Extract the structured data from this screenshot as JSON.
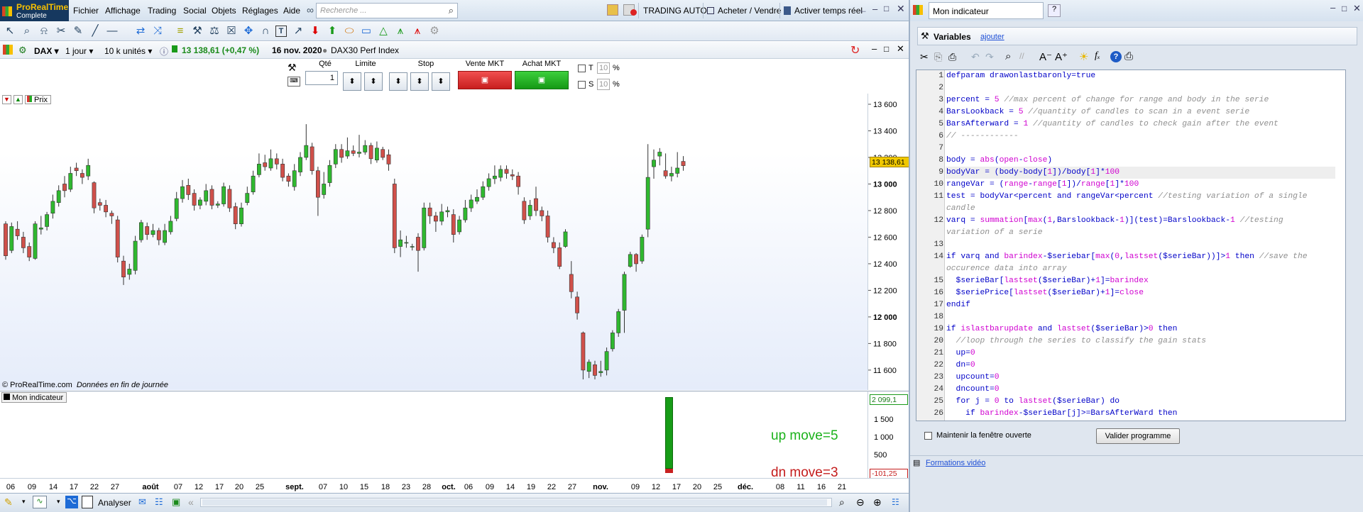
{
  "app": {
    "name_line1": "ProRealTime",
    "name_line2": "Complete"
  },
  "menu": [
    "Fichier",
    "Affichage",
    "Trading",
    "Social",
    "Objets",
    "Réglages",
    "Aide"
  ],
  "search": {
    "placeholder": "Recherche ..."
  },
  "topbar": {
    "trading_auto": "TRADING AUTO",
    "buy_sell": "Acheter / Vendre",
    "realtime": "Activer temps réel"
  },
  "chart_header": {
    "symbol": "DAX",
    "period": "1 jour",
    "units": "10 k unités",
    "price": "13 138,61 (+0,47 %)",
    "date": "16 nov. 2020",
    "name": "DAX30 Perf Index"
  },
  "order": {
    "qty_label": "Qté",
    "qty_value": "1",
    "limit_label": "Limite",
    "stop_label": "Stop",
    "sell_label": "Vente MKT",
    "buy_label": "Achat MKT",
    "t_label": "T",
    "t_value": "10",
    "s_label": "S",
    "s_value": "10",
    "pct": "%"
  },
  "chart": {
    "price_tab": "Prix",
    "copyright": "© ProRealTime.com",
    "eod_note": "Données en fin de journée",
    "current_price_tag": "13 138,61",
    "indicator_tab": "Mon indicateur",
    "up_move_label": "up move=5",
    "dn_move_label": "dn move=3",
    "indicator_top_tag": "2 099,1",
    "indicator_bottom_tag": "-101,25"
  },
  "chart_data": {
    "type": "candlestick",
    "y_ticks": [
      "13 600",
      "13 400",
      "13 200",
      "13 000",
      "12 800",
      "12 600",
      "12 400",
      "12 200",
      "12 000",
      "11 800",
      "11 600"
    ],
    "ylim": [
      11450,
      13680
    ],
    "x_ticks": [
      "06",
      "09",
      "14",
      "17",
      "22",
      "27",
      "août",
      "07",
      "12",
      "17",
      "20",
      "25",
      "sept.",
      "07",
      "10",
      "15",
      "18",
      "23",
      "28",
      "oct.",
      "06",
      "09",
      "14",
      "19",
      "22",
      "27",
      "nov.",
      "09",
      "12",
      "17",
      "20",
      "25",
      "déc.",
      "08",
      "11",
      "16",
      "21"
    ],
    "indicator_ticks": [
      "1 500",
      "1 000",
      "500"
    ],
    "indicator_ylim": [
      -101.25,
      2099.1
    ],
    "candles": [
      [
        12700,
        12460,
        12720,
        12430
      ],
      [
        12500,
        12680,
        12710,
        12480
      ],
      [
        12660,
        12610,
        12720,
        12580
      ],
      [
        12600,
        12520,
        12640,
        12480
      ],
      [
        12530,
        12450,
        12560,
        12420
      ],
      [
        12440,
        12700,
        12720,
        12430
      ],
      [
        12660,
        12670,
        12760,
        12620
      ],
      [
        12680,
        12770,
        12790,
        12650
      ],
      [
        12780,
        12870,
        12920,
        12740
      ],
      [
        12860,
        12950,
        12990,
        12830
      ],
      [
        13000,
        12950,
        13060,
        12900
      ],
      [
        12960,
        13080,
        13130,
        12940
      ],
      [
        13120,
        13100,
        13160,
        13060
      ],
      [
        13080,
        13050,
        13110,
        13000
      ],
      [
        13060,
        13140,
        13190,
        13030
      ],
      [
        13010,
        12820,
        13020,
        12780
      ],
      [
        12860,
        12840,
        12890,
        12800
      ],
      [
        12840,
        12790,
        12880,
        12750
      ],
      [
        12780,
        12760,
        12800,
        12700
      ],
      [
        12730,
        12450,
        12760,
        12410
      ],
      [
        12420,
        12300,
        12460,
        12240
      ],
      [
        12320,
        12360,
        12400,
        12280
      ],
      [
        12350,
        12570,
        12610,
        12320
      ],
      [
        12580,
        12710,
        12730,
        12560
      ],
      [
        12680,
        12620,
        12710,
        12580
      ],
      [
        12620,
        12650,
        12700,
        12600
      ],
      [
        12650,
        12580,
        12670,
        12540
      ],
      [
        12560,
        12650,
        12700,
        12540
      ],
      [
        12640,
        12720,
        12760,
        12620
      ],
      [
        12740,
        12890,
        12940,
        12720
      ],
      [
        12890,
        12980,
        13030,
        12860
      ],
      [
        12990,
        12920,
        13040,
        12880
      ],
      [
        12930,
        12840,
        12960,
        12800
      ],
      [
        12840,
        12880,
        12900,
        12810
      ],
      [
        12870,
        12950,
        13000,
        12840
      ],
      [
        12960,
        12840,
        12990,
        12810
      ],
      [
        12840,
        12850,
        12870,
        12820
      ],
      [
        12850,
        12980,
        13010,
        12830
      ],
      [
        12960,
        12820,
        12990,
        12790
      ],
      [
        12830,
        12700,
        12860,
        12660
      ],
      [
        12700,
        12820,
        12860,
        12680
      ],
      [
        12860,
        12930,
        12980,
        12840
      ],
      [
        12940,
        13060,
        13100,
        12920
      ],
      [
        13070,
        13150,
        13230,
        13050
      ],
      [
        13160,
        13130,
        13220,
        13100
      ],
      [
        13120,
        13190,
        13260,
        13100
      ],
      [
        13190,
        13150,
        13230,
        13110
      ],
      [
        13150,
        13050,
        13190,
        13020
      ],
      [
        13060,
        13020,
        13080,
        12980
      ],
      [
        12980,
        13100,
        13150,
        12950
      ],
      [
        13090,
        13200,
        13240,
        13060
      ],
      [
        13200,
        13290,
        13450,
        13180
      ],
      [
        13280,
        13100,
        13310,
        13070
      ],
      [
        13100,
        12900,
        13130,
        12760
      ],
      [
        12920,
        13000,
        13090,
        12890
      ],
      [
        13010,
        13140,
        13180,
        12980
      ],
      [
        13150,
        13260,
        13300,
        13120
      ],
      [
        13260,
        13200,
        13300,
        13160
      ],
      [
        13210,
        13250,
        13350,
        13190
      ],
      [
        13250,
        13230,
        13290,
        13210
      ],
      [
        13230,
        13240,
        13370,
        13200
      ],
      [
        13240,
        13290,
        13330,
        13220
      ],
      [
        13290,
        13190,
        13310,
        13150
      ],
      [
        13180,
        13270,
        13320,
        13160
      ],
      [
        13260,
        13200,
        13280,
        13180
      ],
      [
        13220,
        13150,
        13260,
        13100
      ],
      [
        13000,
        12520,
        13040,
        12480
      ],
      [
        12530,
        12580,
        12650,
        12450
      ],
      [
        12560,
        12560,
        12610,
        12520
      ],
      [
        12530,
        12530,
        12550,
        12500
      ],
      [
        12600,
        12500,
        12630,
        12340
      ],
      [
        12520,
        12820,
        12860,
        12500
      ],
      [
        12820,
        12760,
        12860,
        12700
      ],
      [
        12760,
        12720,
        12790,
        12640
      ],
      [
        12720,
        12790,
        12850,
        12690
      ],
      [
        12790,
        12800,
        12830,
        12750
      ],
      [
        12770,
        12620,
        12810,
        12560
      ],
      [
        12640,
        12730,
        12760,
        12620
      ],
      [
        12730,
        12820,
        12880,
        12710
      ],
      [
        12820,
        12880,
        12920,
        12790
      ],
      [
        12870,
        12900,
        12960,
        12850
      ],
      [
        12900,
        12980,
        13020,
        12880
      ],
      [
        12980,
        13040,
        13080,
        12950
      ],
      [
        13040,
        13060,
        13140,
        13000
      ],
      [
        13050,
        13110,
        13140,
        13020
      ],
      [
        13110,
        13080,
        13140,
        13040
      ],
      [
        13070,
        13060,
        13110,
        13030
      ],
      [
        13060,
        12980,
        13090,
        12920
      ],
      [
        12870,
        12730,
        12900,
        12700
      ],
      [
        12760,
        12840,
        12880,
        12730
      ],
      [
        12890,
        12800,
        12980,
        12760
      ],
      [
        12800,
        12760,
        12830,
        12720
      ],
      [
        12760,
        12600,
        12800,
        12560
      ],
      [
        12560,
        12520,
        12600,
        12480
      ],
      [
        12520,
        12380,
        12560,
        12360
      ],
      [
        12530,
        12640,
        12660,
        12520
      ],
      [
        12320,
        12190,
        12420,
        12140
      ],
      [
        12150,
        12030,
        12190,
        11980
      ],
      [
        11880,
        11600,
        11890,
        11530
      ],
      [
        11590,
        11660,
        11680,
        11540
      ],
      [
        11640,
        11560,
        11670,
        11530
      ],
      [
        11580,
        11590,
        11670,
        11550
      ],
      [
        11600,
        11740,
        11770,
        11560
      ],
      [
        11760,
        11880,
        11900,
        11740
      ],
      [
        11880,
        12040,
        12060,
        11850
      ],
      [
        12050,
        12320,
        12340,
        11880
      ],
      [
        12380,
        12470,
        12490,
        12370
      ],
      [
        12470,
        12400,
        12480,
        12340
      ],
      [
        12420,
        12600,
        12620,
        12400
      ],
      [
        12660,
        13050,
        13300,
        12600
      ],
      [
        13130,
        13180,
        13260,
        13040
      ],
      [
        13210,
        13240,
        13270,
        13140
      ],
      [
        13100,
        13060,
        13230,
        13040
      ],
      [
        13060,
        13080,
        13130,
        13020
      ],
      [
        13080,
        13120,
        13240,
        13050
      ],
      [
        13170,
        13138,
        13210,
        13100
      ]
    ],
    "indicator_bar_value": 2099.1
  },
  "right_panel": {
    "title": "Mon indicateur",
    "variables_label": "Variables",
    "add_link": "ajouter",
    "keep_open": "Maintenir la fenêtre ouverte",
    "validate": "Valider programme",
    "video_link": "Formations vidéo"
  },
  "code_lines": [
    "1",
    "2",
    "3",
    "4",
    "5",
    "6",
    "",
    "8",
    "9",
    "10",
    "11",
    "",
    "12",
    "",
    "13",
    "14",
    "",
    "15",
    "16",
    "17",
    "18",
    "19",
    "20",
    "21",
    "22",
    "23",
    "24",
    "25",
    "26"
  ],
  "status": {
    "analyse": "Analyser"
  }
}
